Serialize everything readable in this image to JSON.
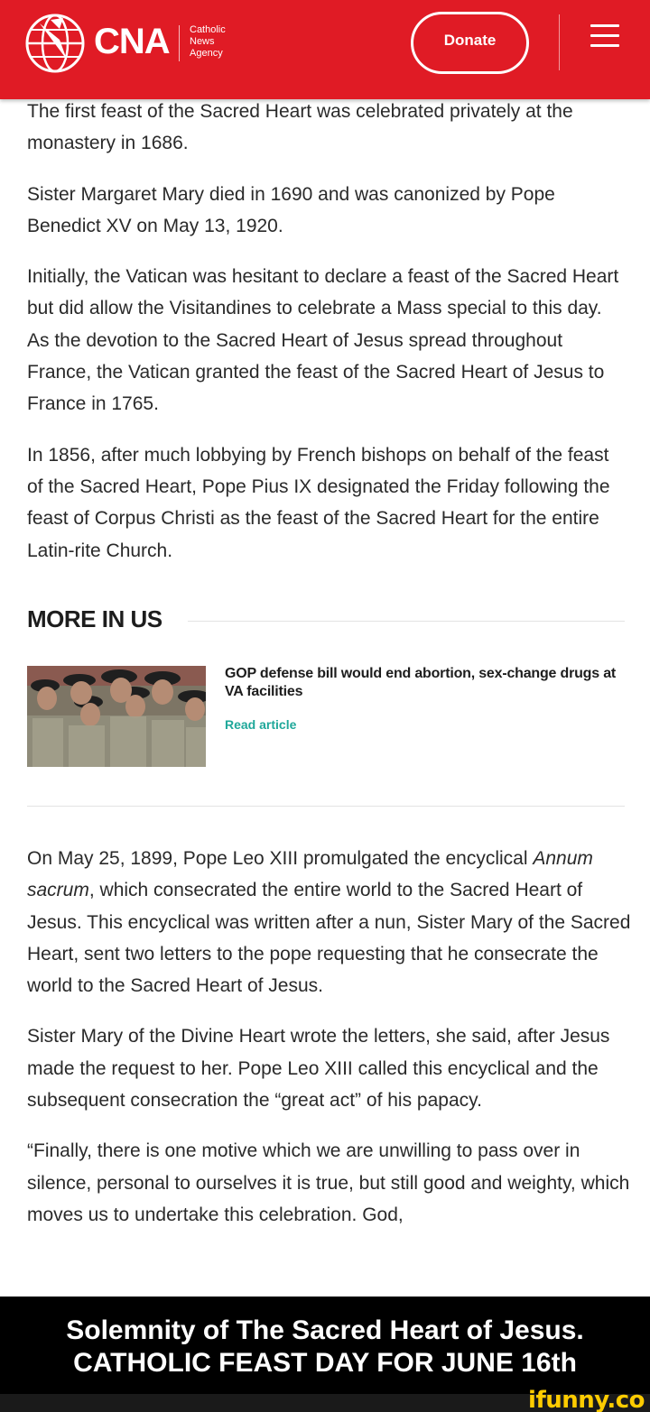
{
  "header": {
    "logo_text": "CNA",
    "logo_tagline": [
      "Catholic",
      "News",
      "Agency"
    ],
    "donate_label": "Donate",
    "brand_color": "#e01b25"
  },
  "article": {
    "paragraphs": [
      "The first feast of the Sacred Heart was celebrated privately at the monastery in 1686.",
      "Sister Margaret Mary died in 1690 and was canonized by Pope Benedict XV on May 13, 1920.",
      "Initially, the Vatican was hesitant to declare a feast of the Sacred Heart but did allow the Visitandines to celebrate a Mass special to this day. As the devotion to the Sacred Heart of Jesus spread throughout France, the Vatican granted the feast of the Sacred Heart of Jesus to France in 1765.",
      "In 1856, after much lobbying by French bishops on behalf of the feast of the Sacred Heart, Pope Pius IX designated the Friday following the feast of Corpus Christi as the feast of the Sacred Heart for the entire Latin-rite Church."
    ]
  },
  "more_in": {
    "title": "MORE IN US",
    "related_title": "GOP defense bill would end abortion, sex-change drugs at VA facilities",
    "related_link": "Read article",
    "link_color": "#1fa89a"
  },
  "article2": {
    "p1_before": "On May 25, 1899, Pope Leo XIII promulgated the encyclical ",
    "p1_italic": "Annum sacrum",
    "p1_after": ", which consecrated the entire world to the Sacred Heart of Jesus. This encyclical was written after a nun, Sister Mary of the Sacred Heart, sent two letters to the pope requesting that he consecrate the world to the Sacred Heart of Jesus.",
    "p2": "Sister Mary of the Divine Heart wrote the letters, she said, after Jesus made the request to her. Pope Leo XIII called this encyclical and the subsequent consecration the “great act” of his papacy.",
    "p3": "“Finally, there is one motive which we are unwilling to pass over in silence, personal to ourselves it is true, but still good and weighty, which moves us to undertake this celebration. God,"
  },
  "caption": {
    "line1": "Solemnity of The Sacred Heart of Jesus.",
    "line2": "CATHOLIC FEAST DAY FOR JUNE 16th"
  },
  "watermark": "ifunny.co"
}
